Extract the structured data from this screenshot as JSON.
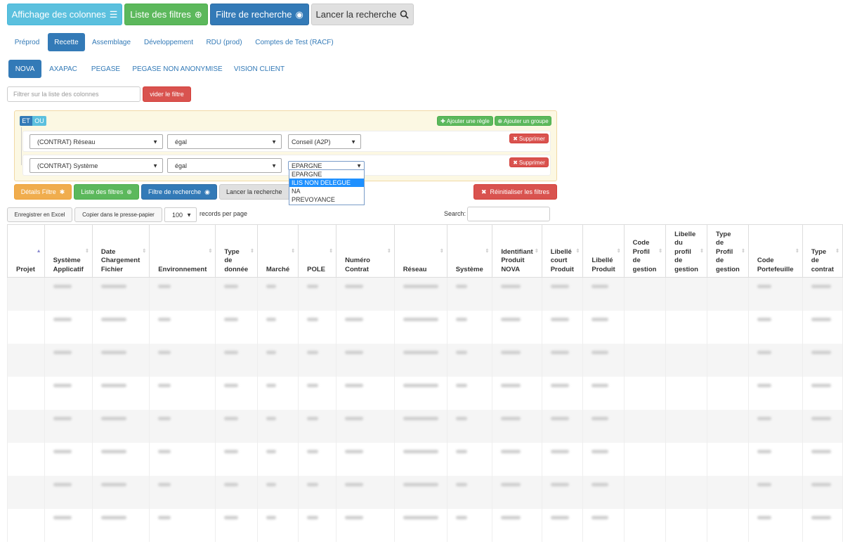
{
  "toolbar": {
    "columns_label": "Affichage des colonnes",
    "filters_label": "Liste des filtres",
    "search_filter_label": "Filtre de recherche",
    "launch_label": "Lancer la recherche"
  },
  "env_tabs": [
    "Préprod",
    "Recette",
    "Assemblage",
    "Développement",
    "RDU (prod)",
    "Comptes de Test (RACF)"
  ],
  "env_active": "Recette",
  "source_tabs": [
    "NOVA",
    "AXAPAC",
    "PEGASE",
    "PEGASE NON ANONYMISE",
    "VISION CLIENT"
  ],
  "source_active": "NOVA",
  "column_filter": {
    "placeholder": "Filtrer sur la liste des colonnes",
    "clear_label": "vider le filtre"
  },
  "builder": {
    "and_label": "ET",
    "or_label": "OU",
    "add_rule_label": "Ajouter une règle",
    "add_group_label": "Ajouter un groupe",
    "delete_label": "Supprimer",
    "rules": [
      {
        "field": "(CONTRAT) Réseau",
        "operator": "égal",
        "value": "Conseil (A2P)"
      },
      {
        "field": "(CONTRAT) Système",
        "operator": "égal",
        "value": "EPARGNE"
      }
    ],
    "dropdown_options": [
      "EPARGNE",
      "ILIS NON DELEGUE",
      "NA",
      "PREVOYANCE"
    ],
    "dropdown_highlighted": "ILIS NON DELEGUE"
  },
  "actions": {
    "details_label": "Détails Filtre",
    "filters_label": "Liste des filtres",
    "search_filter_label": "Filtre de recherche",
    "launch_label": "Lancer la recherche",
    "reset_label": "Réinitialiser les filtres"
  },
  "table_tools": {
    "excel_label": "Enregistrer en Excel",
    "copy_label": "Copier dans le presse-papier",
    "page_size": "100",
    "records_label": "records per page",
    "search_label": "Search:"
  },
  "table": {
    "columns": [
      {
        "label": "Projet",
        "width": 53
      },
      {
        "label": "Système Applicatif",
        "width": 68
      },
      {
        "label": "Date Chargement Fichier",
        "width": 82
      },
      {
        "label": "Environnement",
        "width": 94
      },
      {
        "label": "Type de donnée",
        "width": 60
      },
      {
        "label": "Marché",
        "width": 58
      },
      {
        "label": "POLE",
        "width": 56
      },
      {
        "label": "Numéro Contrat",
        "width": 97
      },
      {
        "label": "Réseau",
        "width": 58
      },
      {
        "label": "Système",
        "width": 65
      },
      {
        "label": "Identifiant Produit NOVA",
        "width": 70
      },
      {
        "label": "Libellé court Produit",
        "width": 59
      },
      {
        "label": "Libellé Produit",
        "width": 58
      },
      {
        "label": "Code Profil de gestion",
        "width": 60
      },
      {
        "label": "Libelle du profil de gestion",
        "width": 59
      },
      {
        "label": "Type de Profil de gestion",
        "width": 58
      },
      {
        "label": "Code Portefeuille",
        "width": 77
      },
      {
        "label": "Type de contrat",
        "width": 56
      }
    ],
    "row_count": 8,
    "sorted_column": "Projet"
  }
}
